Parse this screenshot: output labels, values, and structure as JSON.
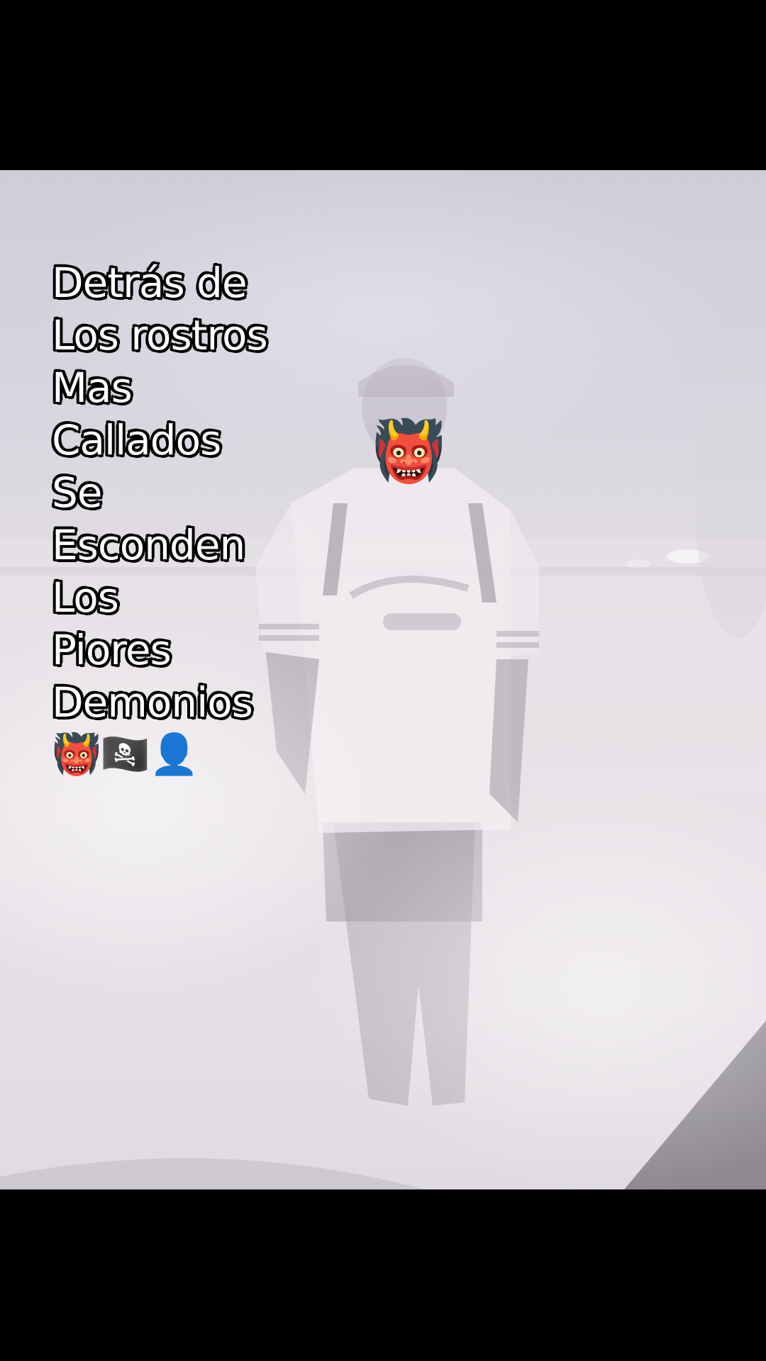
{
  "caption": {
    "lines": [
      "Detrás de",
      "Los rostros",
      "Mas",
      "Callados",
      "Se",
      "Esconden",
      "Los",
      "Piores",
      "Demonios"
    ],
    "emoji_row": "👹🏴‍☠️👤"
  },
  "face_sticker": {
    "emoji": "👹",
    "icon": "ogre-mask-icon"
  },
  "colors": {
    "letterbox": "#000000",
    "caption_fill": "#ffffff",
    "caption_outline": "#000000",
    "smoke": "#e6e0e5"
  }
}
